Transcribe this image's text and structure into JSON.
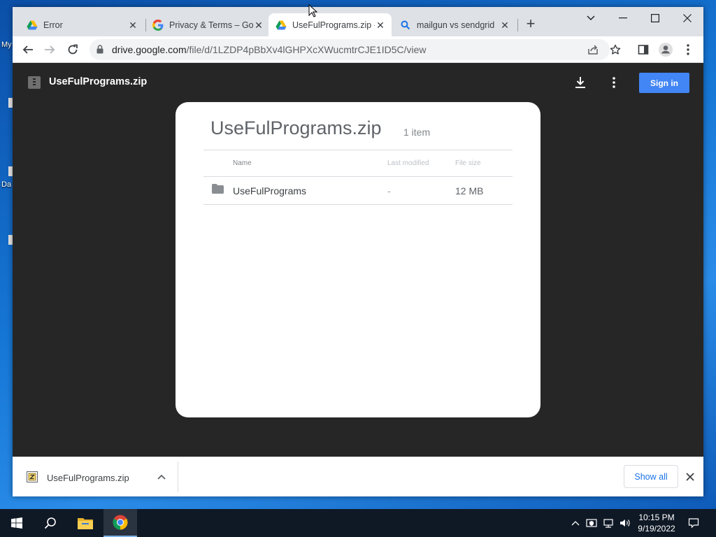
{
  "desktop": {
    "labels": [
      "My",
      "Da"
    ]
  },
  "browser": {
    "tabs": [
      {
        "title": "Error",
        "icon": "google-drive-icon"
      },
      {
        "title": "Privacy & Terms – Google",
        "icon": "google-g-icon"
      },
      {
        "title": "UseFulPrograms.zip - Google Drive",
        "icon": "google-drive-icon"
      },
      {
        "title": "mailgun vs sendgrid",
        "icon": "search-icon"
      }
    ],
    "address": {
      "host": "drive.google.com",
      "path": "/file/d/1LZDP4pBbXv4lGHPXcXWucmtrCJE1ID5C/view"
    }
  },
  "viewer": {
    "file_title": "UseFulPrograms.zip",
    "sign_in_label": "Sign in",
    "card": {
      "title": "UseFulPrograms.zip",
      "count": "1 item",
      "columns": {
        "name": "Name",
        "modified": "Last modified",
        "size": "File size"
      },
      "rows": [
        {
          "name": "UseFulPrograms",
          "modified": "-",
          "size": "12 MB",
          "icon": "folder-icon"
        }
      ]
    }
  },
  "shelf": {
    "download_name": "UseFulPrograms.zip",
    "show_all_label": "Show all"
  },
  "taskbar": {
    "time": "10:15 PM",
    "date": "9/19/2022"
  },
  "colors": {
    "accent": "#4285f4",
    "viewer_bg": "#262626",
    "taskbar_bg": "#0f1926"
  }
}
